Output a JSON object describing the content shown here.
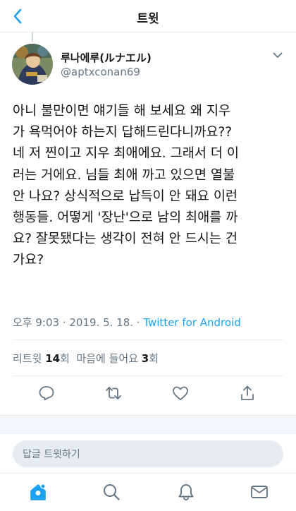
{
  "header": {
    "title": "트윗"
  },
  "author": {
    "display_name": "루나에루(ルナエル)",
    "handle": "@aptxconan69"
  },
  "tweet": {
    "lines": [
      "아니 불만이면 얘기들 해 보세요 왜 지우",
      "가 욕먹어야 하는지 답해드린다니까요??",
      "네 저 찐이고 지우 최애에요. 그래서 더 이",
      "러는 거에요. 님들 최애 까고 있으면 열불",
      "안 나요? 상식적으로 납득이 안 돼요 이런",
      "행동들. 어떻게 '장난'으로 남의 최애를 까",
      "요? 잘못됐다는 생각이 전혀 안 드시는 건",
      "가요?"
    ],
    "timestamp": "오후 9:03 · 2019. 5. 18. · ",
    "source": "Twitter for Android"
  },
  "stats": {
    "retweet_label": "리트윗",
    "retweet_count": "14",
    "retweet_unit": "회",
    "like_label": "마음에 들어요",
    "like_count": "3",
    "like_unit": "회"
  },
  "actions": [
    "reply-icon",
    "retweet-icon",
    "like-icon",
    "share-icon"
  ],
  "reply": {
    "placeholder": "답글 트윗하기"
  },
  "tabs": [
    "home-icon",
    "search-icon",
    "notifications-icon",
    "messages-icon"
  ],
  "colors": {
    "accent": "#1da1f2",
    "text": "#14171a",
    "muted": "#657786",
    "border": "#e6ecf0"
  }
}
